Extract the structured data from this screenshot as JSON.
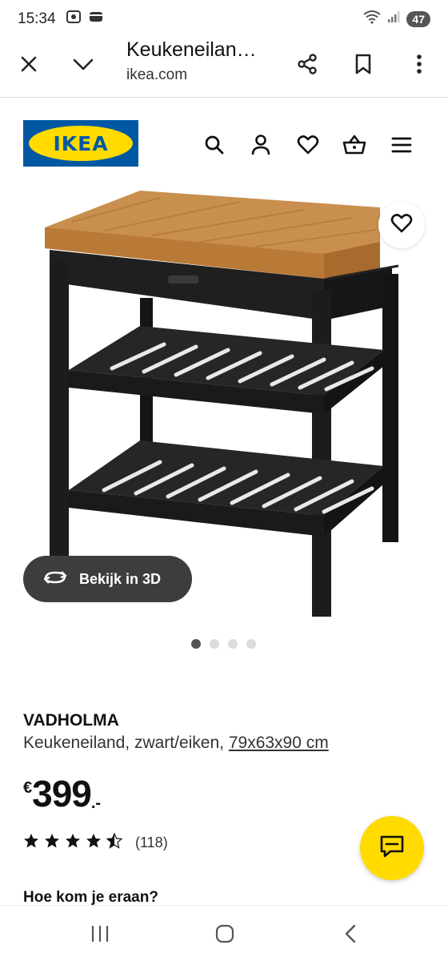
{
  "status_bar": {
    "time": "15:34",
    "battery": "47"
  },
  "browser": {
    "title": "Keukeneilan…",
    "url": "ikea.com",
    "icons": [
      "close-icon",
      "chevron-down-icon",
      "share-icon",
      "bookmark-icon",
      "more-vert-icon"
    ]
  },
  "header": {
    "logo_text": "IKEA",
    "icons": [
      "search-icon",
      "user-icon",
      "heart-icon",
      "basket-icon",
      "menu-icon"
    ]
  },
  "image": {
    "view3d_label": "Bekijk in 3D",
    "carousel": {
      "total": 4,
      "active": 1
    }
  },
  "product": {
    "name": "VADHOLMA",
    "description": "Keukeneiland, zwart/eiken,",
    "size": "79x63x90 cm",
    "price": {
      "currency": "€",
      "amount": "399",
      "suffix": ".-"
    },
    "rating": {
      "stars": 4.5,
      "max": 5,
      "count": "(118)"
    }
  },
  "section_heading": "Hoe kom je eraan?",
  "colors": {
    "ikea_blue": "#0058a3",
    "ikea_yellow": "#ffdb00",
    "button_dark": "#3d3d3d"
  }
}
